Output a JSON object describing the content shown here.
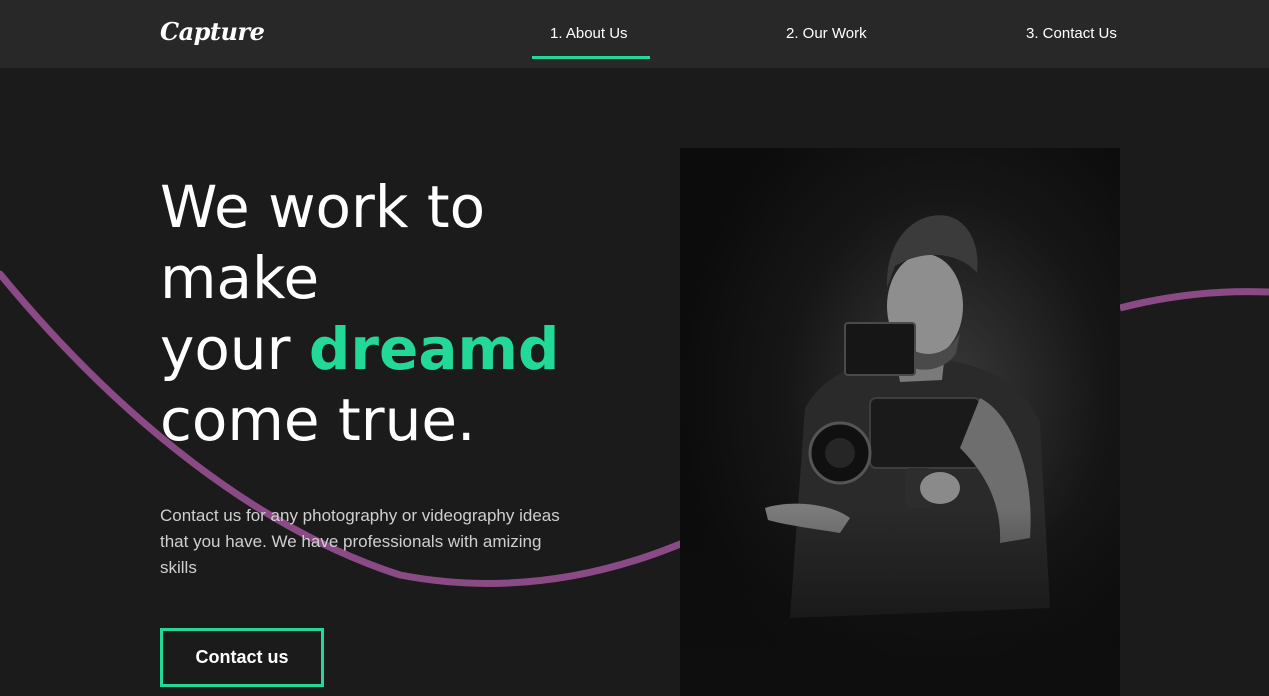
{
  "nav": {
    "logo": "Capture",
    "links": [
      {
        "label": "1. About Us",
        "active": true
      },
      {
        "label": "2. Our Work",
        "active": false
      },
      {
        "label": "3. Contact Us",
        "active": false
      }
    ]
  },
  "hero": {
    "headline": {
      "line1": "We work to",
      "line2": "make",
      "line3_prefix": "your ",
      "line3_accent": "dreamd",
      "line4": "come true."
    },
    "description": "Contact us for any photography or videography ideas that you have. We have professionals with amizing skills",
    "cta_label": "Contact us"
  },
  "colors": {
    "accent": "#23d997",
    "swirl": "#8a4a86",
    "background": "#1b1b1b",
    "nav_background": "#282828"
  }
}
